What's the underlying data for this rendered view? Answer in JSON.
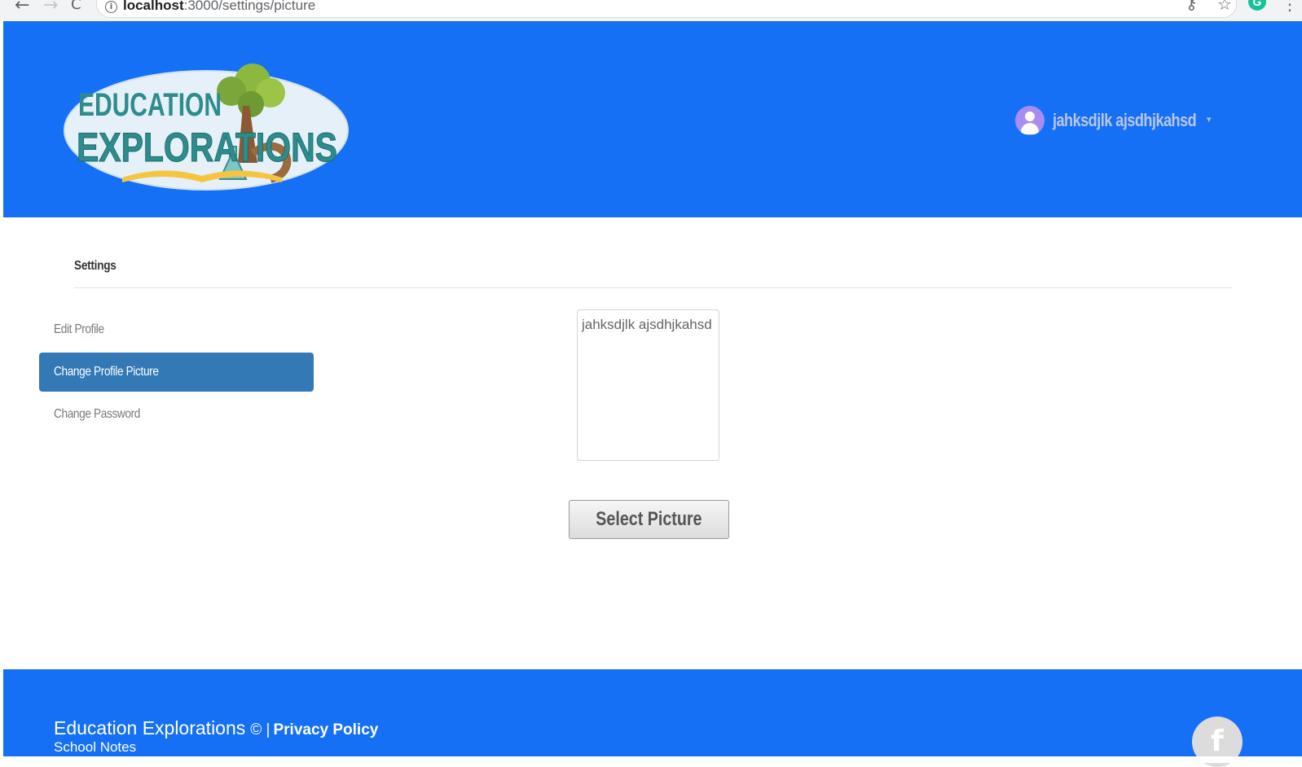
{
  "browser": {
    "back_glyph": "←",
    "forward_glyph": "→",
    "reload_glyph": "C",
    "info_glyph": "i",
    "url_host": "localhost",
    "url_path": ":3000/settings/picture",
    "key_glyph": "⚷",
    "star_glyph": "☆",
    "extension_glyph": "G",
    "menu_glyph": "⋮"
  },
  "header": {
    "logo_line1": "EDUCATION",
    "logo_line2": "EXPLORATIONS",
    "user_name": "jahksdjlk ajsdhjkahsd",
    "caret": "▾",
    "colors": {
      "bar": "#1570f5",
      "avatar": "#a98cf0"
    }
  },
  "settings": {
    "title": "Settings",
    "menu": [
      {
        "label": "Edit Profile",
        "active": false
      },
      {
        "label": "Change Profile Picture",
        "active": true
      },
      {
        "label": "Change Password",
        "active": false
      }
    ]
  },
  "picture": {
    "alt_text": "jahksdjlk ajsdhjkahsd",
    "select_label": "Select Picture"
  },
  "footer": {
    "brand": "Education Explorations",
    "copyright": "© |",
    "privacy_label": "Privacy Policy",
    "notes_label": "School Notes",
    "facebook_glyph": "f"
  }
}
